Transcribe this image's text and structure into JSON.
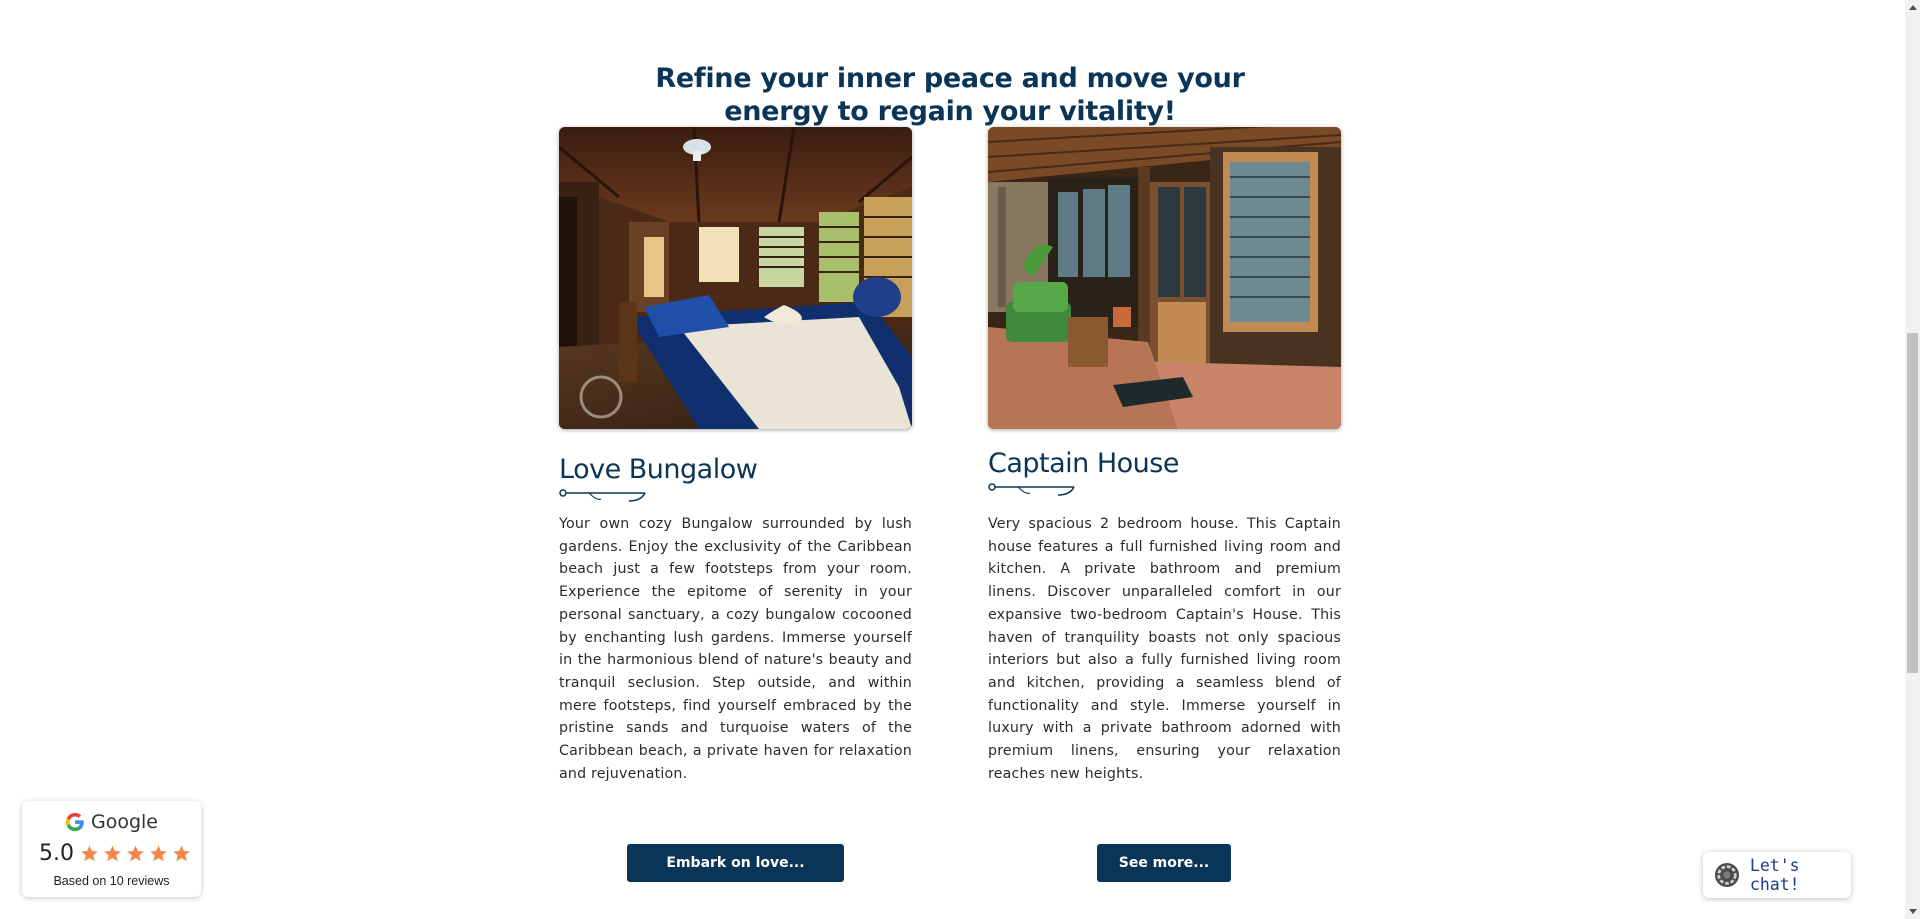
{
  "heading": {
    "line1": "Refine your inner peace and move your",
    "line2": "energy to regain your vitality!"
  },
  "cards": [
    {
      "title": "Love Bungalow",
      "image_alt": "bungalow-bedroom-photo",
      "description": "Your own cozy Bungalow  surrounded by lush gardens. Enjoy the exclusivity of the Caribbean beach just a few footsteps from your room.  Experience the epitome of serenity in your personal sanctuary, a cozy bungalow cocooned by enchanting lush gardens. Immerse yourself in the harmonious blend of nature's beauty and tranquil seclusion. Step outside, and within mere footsteps, find yourself embraced by the pristine sands and turquoise waters of the Caribbean beach, a private haven for relaxation and rejuvenation.",
      "button": "Embark on love..."
    },
    {
      "title": "Captain House",
      "image_alt": "captain-house-porch-photo",
      "description": "Very spacious 2 bedroom house. This Captain house features a full furnished living room and kitchen. A private bathroom and premium linens. Discover unparalleled comfort in our expansive two-bedroom Captain's House. This haven of tranquility boasts not only spacious interiors but also a fully furnished living room and kitchen, providing a seamless blend of functionality and style. Immerse yourself in luxury with a private bathroom adorned with premium linens, ensuring your relaxation reaches new heights.",
      "button": "See more..."
    }
  ],
  "google_widget": {
    "brand": "Google",
    "score": "5.0",
    "stars": 5,
    "based_on": "Based on 10 reviews",
    "star_color": "#f2894a"
  },
  "chat": {
    "label": "Let's chat!"
  },
  "colors": {
    "brand_navy": "#0b3557",
    "body_text": "#2b2b2b"
  }
}
